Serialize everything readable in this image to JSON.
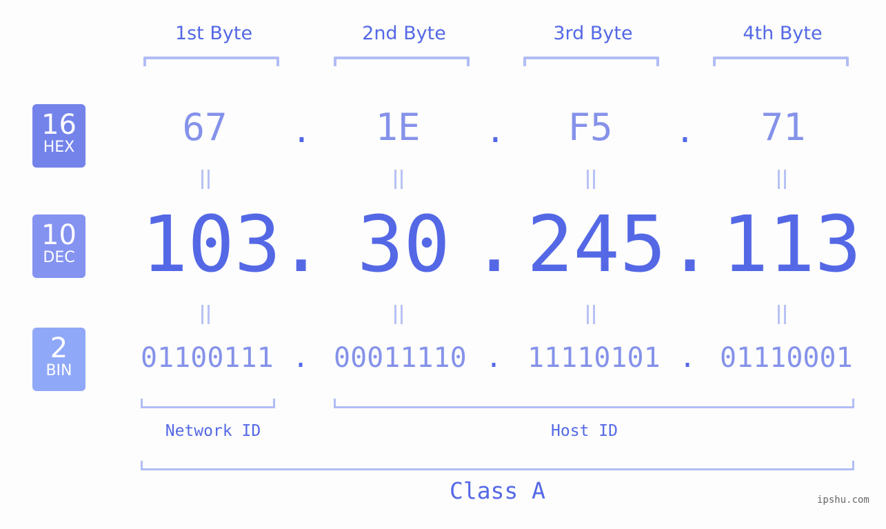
{
  "bytes": [
    {
      "label": "1st Byte",
      "hex": "67",
      "dec": "103",
      "bin": "01100111"
    },
    {
      "label": "2nd Byte",
      "hex": "1E",
      "dec": "30",
      "bin": "00011110"
    },
    {
      "label": "3rd Byte",
      "hex": "F5",
      "dec": "245",
      "bin": "11110101"
    },
    {
      "label": "4th Byte",
      "hex": "71",
      "dec": "113",
      "bin": "01110001"
    }
  ],
  "separator": ".",
  "badges": {
    "hex": {
      "base": "16",
      "name": "HEX",
      "color": "#7383ea"
    },
    "dec": {
      "base": "10",
      "name": "DEC",
      "color": "#8492f0"
    },
    "bin": {
      "base": "2",
      "name": "BIN",
      "color": "#90a8f8"
    }
  },
  "segments": {
    "network": "Network ID",
    "host": "Host ID"
  },
  "ip_class": "Class A",
  "watermark": "ipshu.com",
  "colors": {
    "primary": "#5468e6",
    "secondary": "#8592ea",
    "bracket": "#b1bcf6"
  }
}
